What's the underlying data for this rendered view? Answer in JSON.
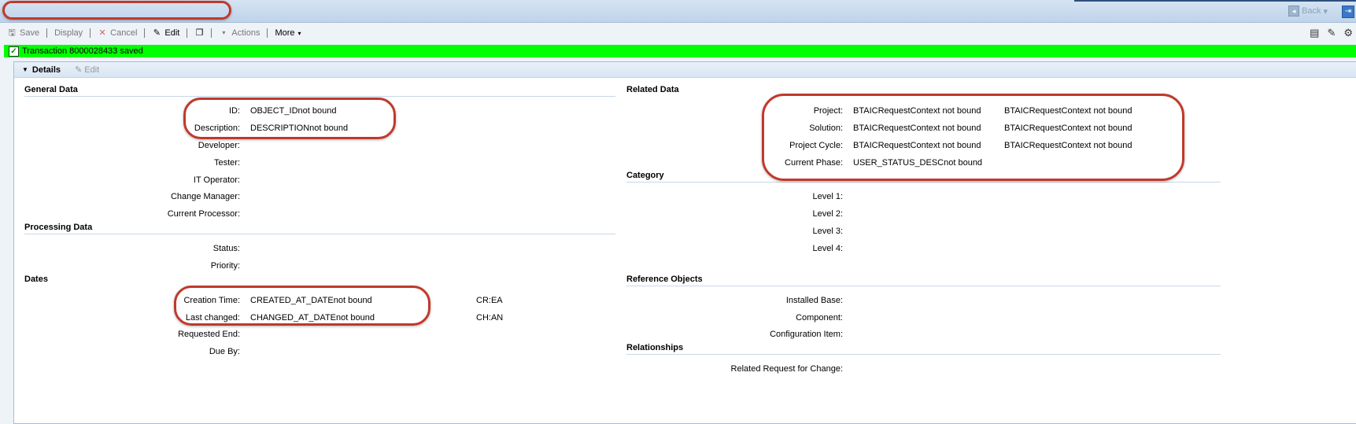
{
  "titlebar": {
    "title": "",
    "back_label": "Back"
  },
  "toolbar": {
    "save": "Save",
    "display": "Display",
    "cancel": "Cancel",
    "edit": "Edit",
    "actions": "Actions",
    "more": "More"
  },
  "message": "Transaction 8000028433 saved",
  "panel": {
    "title": "Details",
    "edit": "Edit"
  },
  "general": {
    "heading": "General Data",
    "id_label": "ID:",
    "id_value": "OBJECT_IDnot bound",
    "desc_label": "Description:",
    "desc_value": "DESCRIPTIONnot bound",
    "developer": "Developer:",
    "tester": "Tester:",
    "it_operator": "IT Operator:",
    "change_manager": "Change Manager:",
    "current_processor": "Current Processor:"
  },
  "processing": {
    "heading": "Processing Data",
    "status": "Status:",
    "priority": "Priority:"
  },
  "dates": {
    "heading": "Dates",
    "creation_label": "Creation Time:",
    "creation_value": "CREATED_AT_DATEnot bound",
    "creation_extra": "CR:EA",
    "changed_label": "Last changed:",
    "changed_value": "CHANGED_AT_DATEnot bound",
    "changed_extra": "CH:AN",
    "requested_end": "Requested End:",
    "due_by": "Due By:"
  },
  "related": {
    "heading": "Related Data",
    "project_label": "Project:",
    "project_v1": "BTAICRequestContext not bound",
    "project_v2": "BTAICRequestContext not bound",
    "solution_label": "Solution:",
    "solution_v1": "BTAICRequestContext not bound",
    "solution_v2": "BTAICRequestContext not bound",
    "cycle_label": "Project Cycle:",
    "cycle_v1": "BTAICRequestContext not bound",
    "cycle_v2": "BTAICRequestContext not bound",
    "phase_label": "Current Phase:",
    "phase_v1": "USER_STATUS_DESCnot bound"
  },
  "category": {
    "heading": "Category",
    "l1": "Level 1:",
    "l2": "Level 2:",
    "l3": "Level 3:",
    "l4": "Level 4:"
  },
  "reference": {
    "heading": "Reference Objects",
    "installed_base": "Installed Base:",
    "component": "Component:",
    "config_item": "Configuration Item:"
  },
  "relationships": {
    "heading": "Relationships",
    "related_request": "Related Request for Change:"
  },
  "colors": {
    "message_bg": "#00ff00",
    "annotation": "#c0392b",
    "header_blue": "#bfd3ea"
  }
}
